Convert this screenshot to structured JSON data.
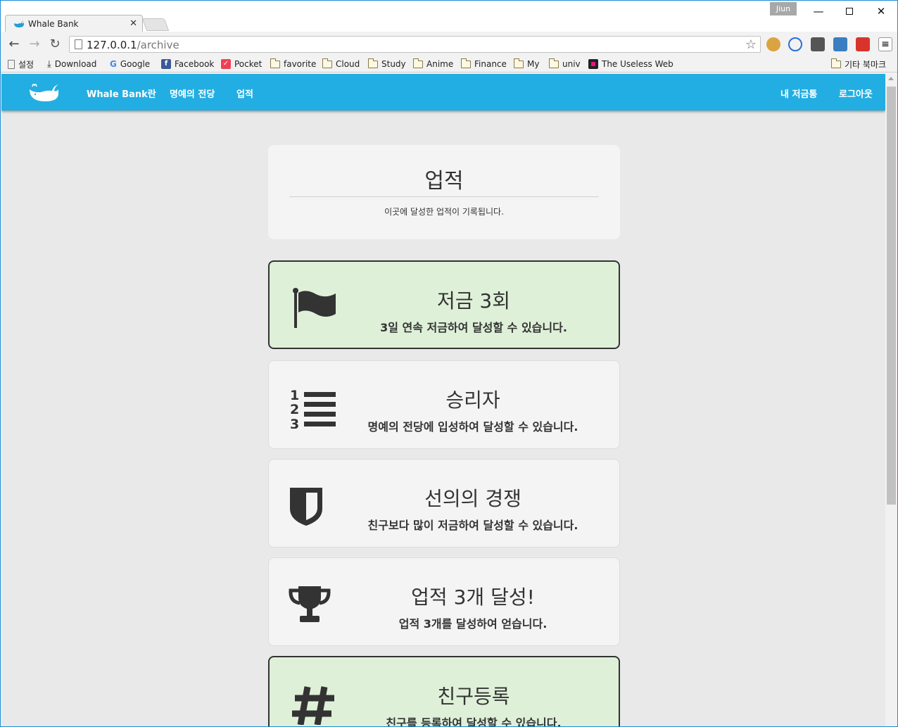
{
  "browser": {
    "tab_title": "Whale Bank",
    "profile_name": "Jiun",
    "url_host": "127.0.0.1",
    "url_path": "/archive",
    "bookmarks": [
      {
        "label": "설정",
        "icon": "page-icon"
      },
      {
        "label": "Download",
        "icon": "download-icon"
      },
      {
        "label": "Google",
        "icon": "google-icon"
      },
      {
        "label": "Facebook",
        "icon": "facebook-icon"
      },
      {
        "label": "Pocket",
        "icon": "pocket-icon"
      },
      {
        "label": "favorite",
        "icon": "folder-icon"
      },
      {
        "label": "Cloud",
        "icon": "folder-icon"
      },
      {
        "label": "Study",
        "icon": "folder-icon"
      },
      {
        "label": "Anime",
        "icon": "folder-icon"
      },
      {
        "label": "Finance",
        "icon": "folder-icon"
      },
      {
        "label": "My",
        "icon": "folder-icon"
      },
      {
        "label": "univ",
        "icon": "folder-icon"
      },
      {
        "label": "The Useless Web",
        "icon": "useless-web-icon"
      }
    ],
    "other_bookmarks": "기타 북마크"
  },
  "navbar": {
    "logo_icon": "whale-logo-icon",
    "links": [
      "Whale Bank란",
      "명예의 전당",
      "업적"
    ],
    "right_links": [
      "내 저금통",
      "로그아웃"
    ],
    "color": "#22aee2"
  },
  "header": {
    "title": "업적",
    "subtitle": "이곳에 달성한 업적이 기록됩니다."
  },
  "achievements": [
    {
      "title": "저금 3회",
      "desc": "3일 연속 저금하여 달성할 수 있습니다.",
      "icon": "flag-icon",
      "achieved": true
    },
    {
      "title": "승리자",
      "desc": "명예의 전당에 입성하여 달성할 수 있습니다.",
      "icon": "ranked-list-icon",
      "achieved": false
    },
    {
      "title": "선의의 경쟁",
      "desc": "친구보다 많이 저금하여 달성할 수 있습니다.",
      "icon": "shield-icon",
      "achieved": false
    },
    {
      "title": "업적 3개 달성!",
      "desc": "업적 3개를 달성하여 얻습니다.",
      "icon": "trophy-icon",
      "achieved": false
    },
    {
      "title": "친구등록",
      "desc": "친구를 등록하여 달성할 수 있습니다.",
      "icon": "hashtag-icon",
      "achieved": true
    }
  ],
  "colors": {
    "achieved_bg": "#dff0d8",
    "card_bg": "#f4f4f4",
    "page_bg": "#e9e9e9"
  }
}
